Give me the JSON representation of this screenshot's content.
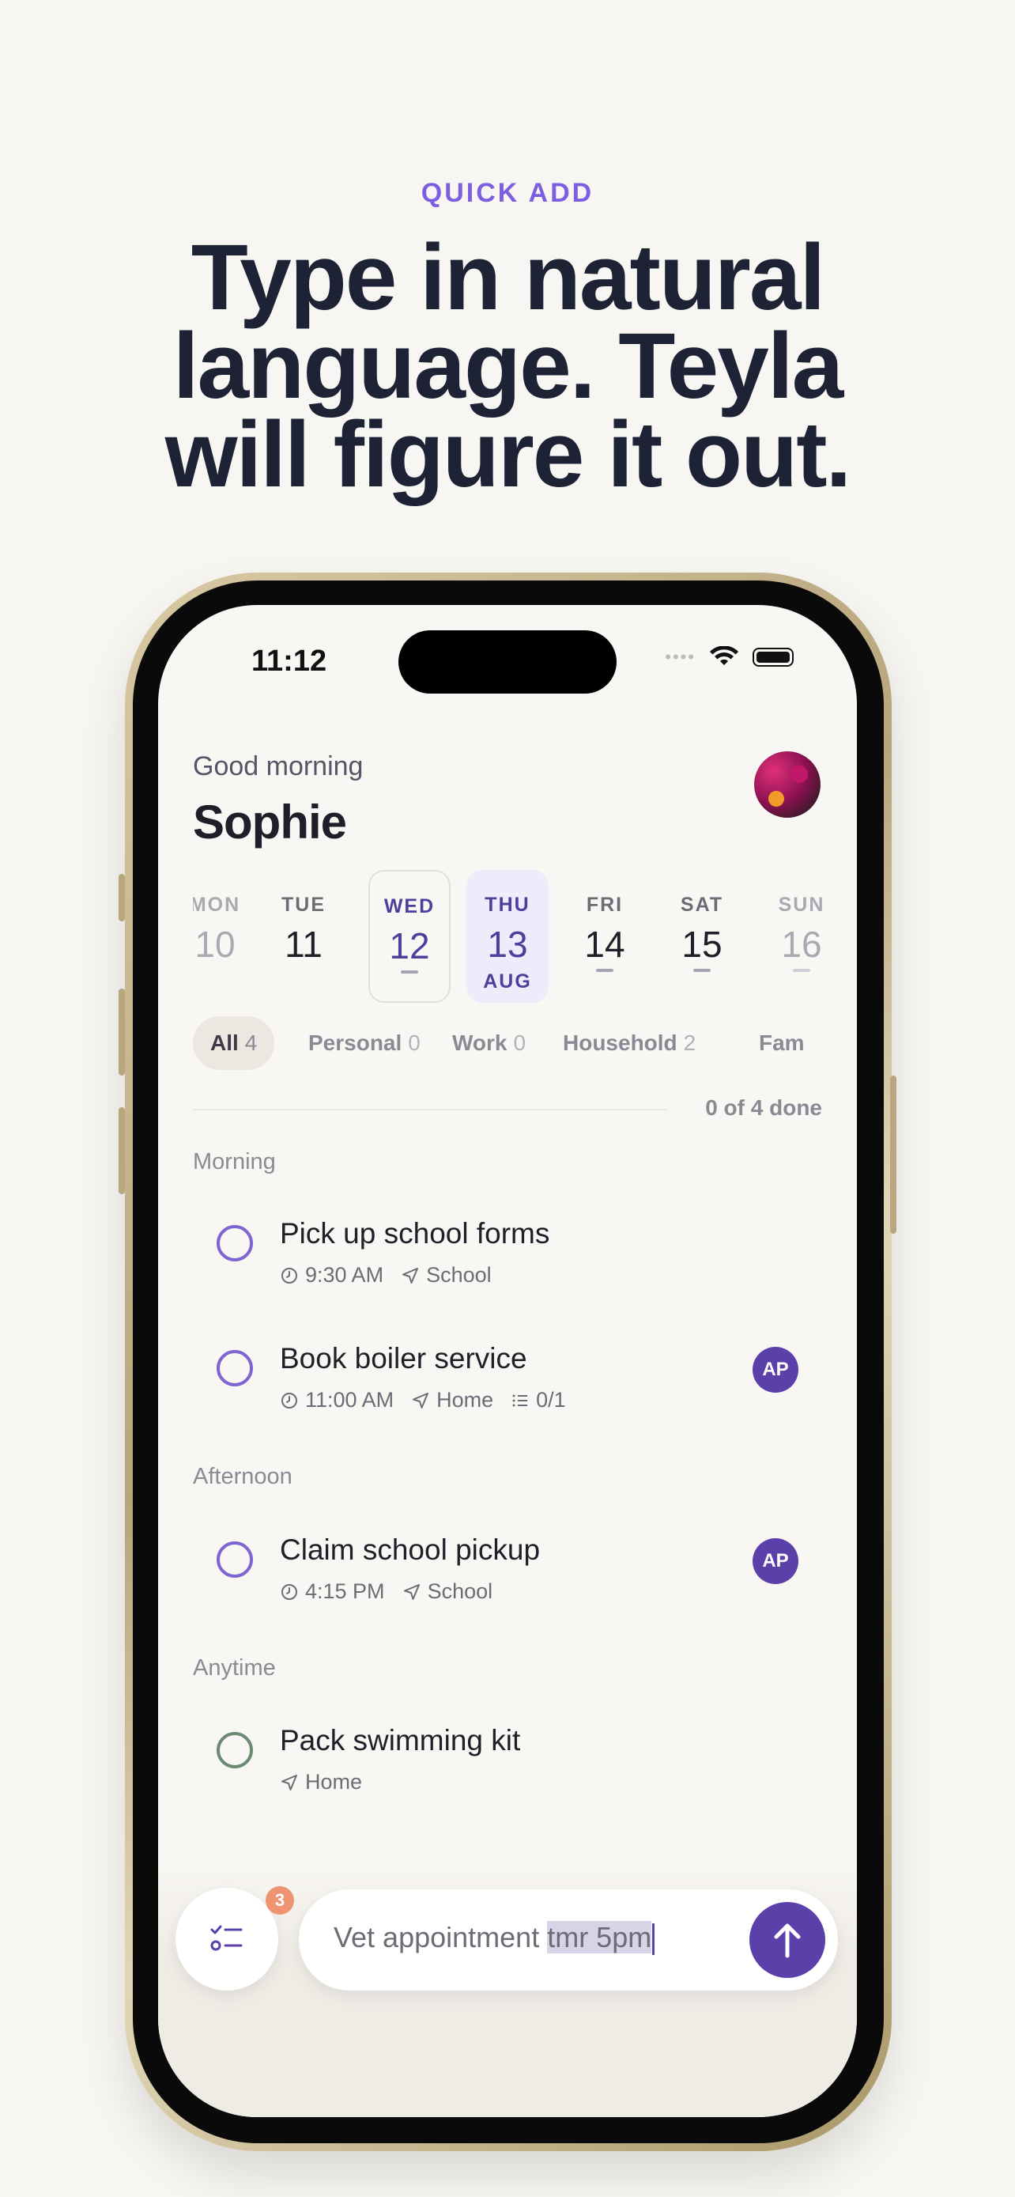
{
  "promo": {
    "eyebrow": "QUICK ADD",
    "headline": "Type in natural language. Teyla will figure it out."
  },
  "status_bar": {
    "time": "11:12"
  },
  "header": {
    "greeting": "Good morning",
    "name": "Sophie"
  },
  "week": [
    {
      "day": "MON",
      "date": "10"
    },
    {
      "day": "TUE",
      "date": "11"
    },
    {
      "day": "WED",
      "date": "12"
    },
    {
      "day": "THU",
      "date": "13",
      "month": "AUG"
    },
    {
      "day": "FRI",
      "date": "14"
    },
    {
      "day": "SAT",
      "date": "15"
    },
    {
      "day": "SUN",
      "date": "16"
    }
  ],
  "filters": [
    {
      "label": "All",
      "count": "4"
    },
    {
      "label": "Personal",
      "count": "0"
    },
    {
      "label": "Work",
      "count": "0"
    },
    {
      "label": "Household",
      "count": "2"
    },
    {
      "label": "Fam",
      "count": ""
    }
  ],
  "progress": "0 of 4 done",
  "sections": {
    "morning": "Morning",
    "afternoon": "Afternoon",
    "anytime": "Anytime"
  },
  "tasks": [
    {
      "title": "Pick up school forms",
      "time": "9:30 AM",
      "place": "School"
    },
    {
      "title": "Book boiler service",
      "time": "11:00 AM",
      "place": "Home",
      "subtasks": "0/1",
      "assignee": "AP"
    },
    {
      "title": "Claim school pickup",
      "time": "4:15 PM",
      "place": "School",
      "assignee": "AP"
    },
    {
      "title": "Pack swimming kit",
      "place": "Home"
    }
  ],
  "quick_add": {
    "badge_count": "3",
    "text_plain": "Vet appointment ",
    "text_highlight": "tmr 5pm"
  },
  "colors": {
    "accent": "#5a40a8",
    "eyebrow": "#7c5fe0",
    "headline": "#1e2235",
    "background": "#f8f6f2"
  }
}
